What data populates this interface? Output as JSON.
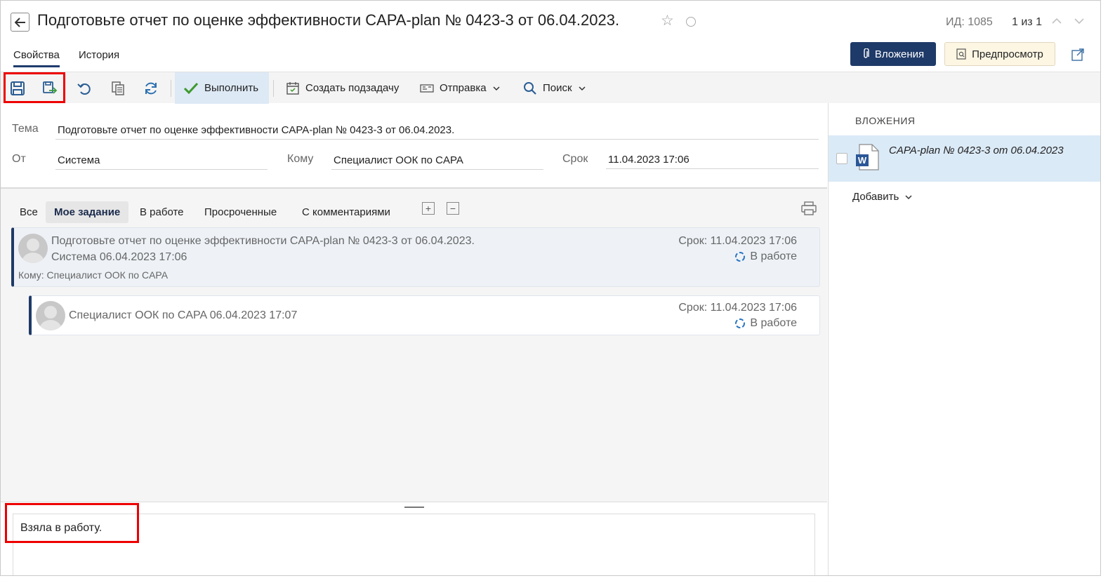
{
  "header": {
    "title": "Подготовьте отчет по оценке эффективности CAPA-plan № 0423-3 от 06.04.2023.",
    "id_label": "ИД: 1085",
    "counter": "1 из 1"
  },
  "tabs": [
    {
      "label": "Свойства",
      "active": true
    },
    {
      "label": "История",
      "active": false
    }
  ],
  "buttons": {
    "attachments": "Вложения",
    "preview": "Предпросмотр"
  },
  "toolbar": {
    "run": "Выполнить",
    "create_subtask": "Создать подзадачу",
    "send": "Отправка",
    "search": "Поиск"
  },
  "fields": {
    "subject_label": "Тема",
    "subject_value": "Подготовьте отчет по оценке эффективности CAPA-plan № 0423-3  от 06.04.2023.",
    "from_label": "От",
    "from_value": "Система",
    "to_label": "Кому",
    "to_value": "Специалист ООК по CAPA",
    "deadline_label": "Срок",
    "deadline_value": "11.04.2023 17:06"
  },
  "filters": [
    {
      "label": "Все",
      "active": false
    },
    {
      "label": "Мое задание",
      "active": true
    },
    {
      "label": "В работе",
      "active": false
    },
    {
      "label": "Просроченные",
      "active": false
    },
    {
      "label": "С комментариями",
      "active": false
    }
  ],
  "tasks": [
    {
      "title": "Подготовьте отчет по оценке эффективности CAPA-plan № 0423-3 от 06.04.2023.",
      "author_date": "Система   06.04.2023 17:06",
      "recipient": "Кому: Специалист ООК по CAPA",
      "deadline": "Срок: 11.04.2023 17:06",
      "status": "В работе"
    },
    {
      "author_date": "Специалист ООК по CAPA   06.04.2023 17:07",
      "deadline": "Срок: 11.04.2023 17:06",
      "status": "В работе"
    }
  ],
  "attachments_panel": {
    "title": "ВЛОЖЕНИЯ",
    "file_name": "CAPA-plan № 0423-3 от 06.04.2023",
    "add_label": "Добавить"
  },
  "comment": {
    "text": "Взяла в работу."
  },
  "colors": {
    "accent": "#1e3a68",
    "highlight": "#e00000",
    "selection": "#dbeaf7"
  }
}
